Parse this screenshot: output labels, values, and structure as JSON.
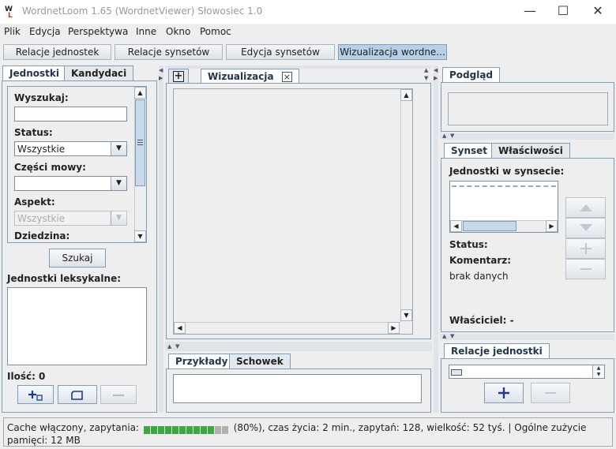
{
  "window": {
    "title": "WordnetLoom 1.65 (WordnetViewer) Słowosiec 1.0"
  },
  "menu": [
    "Plik",
    "Edycja",
    "Perspektywa",
    "Inne",
    "Okno",
    "Pomoc"
  ],
  "topbuttons": [
    "Relacje jednostek",
    "Relacje synsetów",
    "Edycja synsetów",
    "Wizualizacja wordne..."
  ],
  "left": {
    "tabs": [
      "Jednostki",
      "Kandydaci"
    ],
    "search_label": "Wyszukaj:",
    "search_value": "",
    "status_label": "Status:",
    "status_value": "Wszystkie",
    "pos_label": "Części mowy:",
    "pos_value": "",
    "aspect_label": "Aspekt:",
    "aspect_value": "Wszystkie",
    "domain_label": "Dziedzina:",
    "search_button": "Szukaj",
    "units_label": "Jednostki leksykalne:",
    "count_label": "Ilość: 0"
  },
  "center": {
    "tab_add": "+",
    "tab_label": "Wizualizacja",
    "tab_close": "×",
    "bottom_tabs": [
      "Przykłady",
      "Schowek"
    ]
  },
  "right": {
    "preview_tab": "Podgląd",
    "tabs": [
      "Synset",
      "Właściwości"
    ],
    "synset_units_label": "Jednostki w synsecie:",
    "status_label": "Status:",
    "comment_label": "Komentarz:",
    "comment_value": "brak danych",
    "owner_label": "Właściciel: -",
    "relations_tab": "Relacje jednostki"
  },
  "statusbar": {
    "text_before": "Cache włączony, zapytania:",
    "progress_percent": 80,
    "text_after": "(80%), czas życia: 2 min., zapytań: 128, wielkość: 52 tyś. | Ogólne zużycie pamięci: 12 MB"
  },
  "colors": {
    "accent": "#7b9ebd",
    "progress": "#3aa843",
    "progress_empty": "#b0b0b0",
    "active_tab": "#b8cfe5"
  }
}
